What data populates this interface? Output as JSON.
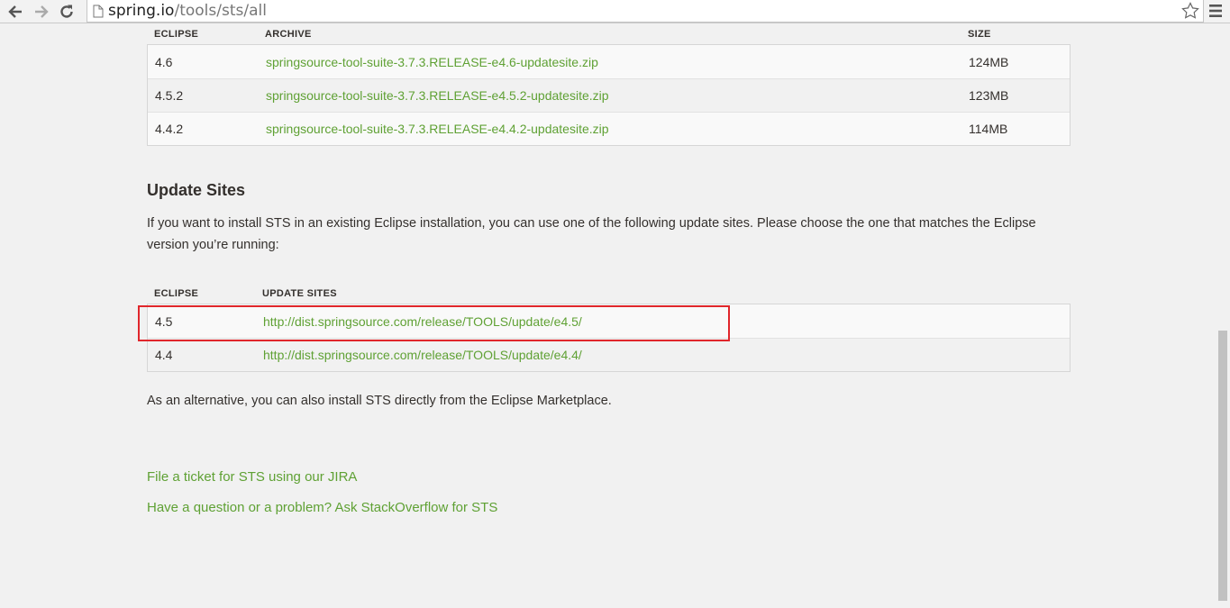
{
  "browser": {
    "url_host": "spring.io",
    "url_path": "/tools/sts/all"
  },
  "archive_table": {
    "headers": {
      "eclipse": "ECLIPSE",
      "archive": "ARCHIVE",
      "size": "SIZE"
    },
    "rows": [
      {
        "eclipse": "4.6",
        "archive": "springsource-tool-suite-3.7.3.RELEASE-e4.6-updatesite.zip",
        "size": "124MB"
      },
      {
        "eclipse": "4.5.2",
        "archive": "springsource-tool-suite-3.7.3.RELEASE-e4.5.2-updatesite.zip",
        "size": "123MB"
      },
      {
        "eclipse": "4.4.2",
        "archive": "springsource-tool-suite-3.7.3.RELEASE-e4.4.2-updatesite.zip",
        "size": "114MB"
      }
    ]
  },
  "update_sites": {
    "heading": "Update Sites",
    "intro": "If you want to install STS in an existing Eclipse installation, you can use one of the following update sites. Please choose the one that matches the Eclipse version you’re running:",
    "headers": {
      "eclipse": "ECLIPSE",
      "sites": "UPDATE SITES"
    },
    "rows": [
      {
        "eclipse": "4.5",
        "url": "http://dist.springsource.com/release/TOOLS/update/e4.5/"
      },
      {
        "eclipse": "4.4",
        "url": "http://dist.springsource.com/release/TOOLS/update/e4.4/"
      }
    ],
    "alternative": "As an alternative, you can also install STS directly from the Eclipse Marketplace."
  },
  "links": {
    "jira": "File a ticket for STS using our JIRA",
    "stackoverflow": "Have a question or a problem? Ask StackOverflow for STS"
  },
  "colors": {
    "link": "#5fa134",
    "highlight": "#e0262b"
  },
  "icons": {
    "back": "back-arrow-icon",
    "forward": "forward-arrow-icon",
    "reload": "reload-icon",
    "page": "page-icon",
    "star": "star-icon",
    "menu": "hamburger-menu-icon"
  }
}
